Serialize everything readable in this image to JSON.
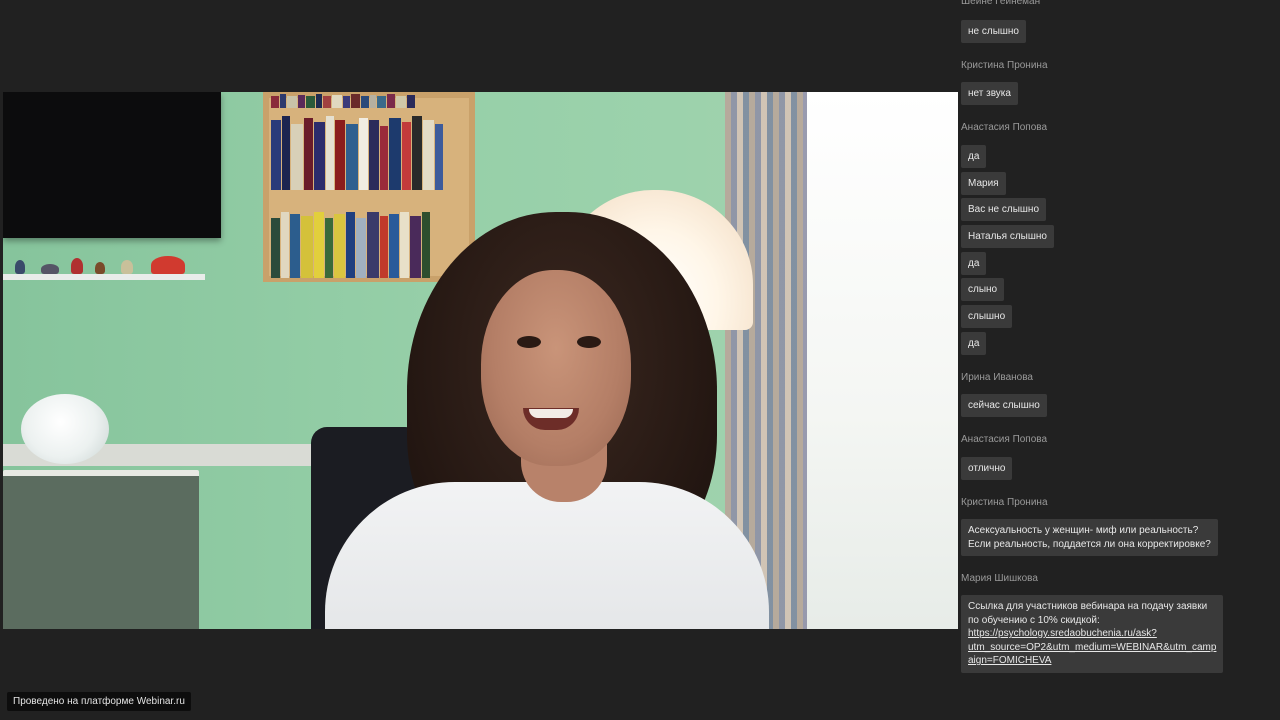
{
  "chat": {
    "top_author": "Шейне Гейнеман",
    "messages": [
      {
        "text": "не слышно"
      },
      {
        "author": "Кристина Пронина"
      },
      {
        "text": "нет звука"
      },
      {
        "author": "Анастасия Попова"
      },
      {
        "text": "да"
      },
      {
        "text": "Мария"
      },
      {
        "text": "Вас не слышно"
      },
      {
        "text": "Наталья слышно"
      },
      {
        "text": "да"
      },
      {
        "text": "слыно"
      },
      {
        "text": "слышно"
      },
      {
        "text": "да"
      },
      {
        "author": "Ирина Иванова"
      },
      {
        "text": "сейчас слышно"
      },
      {
        "author": "Анастасия Попова"
      },
      {
        "text": "отлично"
      },
      {
        "author": "Кристина Пронина"
      },
      {
        "lines": [
          "Асексуальность у женщин- миф или реальность?",
          "Если реальность, поддается ли она корректировке?"
        ]
      },
      {
        "author": "Мария Шишкова"
      },
      {
        "lines": [
          "Ссылка для участников вебинара на подачу заявки",
          "по обучению с 10% скидкой:"
        ],
        "link_lines": [
          "https://psychology.sredaobuchenia.ru/ask?",
          "utm_source=OP2&utm_medium=WEBINAR&utm_camp",
          "aign=FOMICHEVA"
        ]
      }
    ]
  },
  "footer": {
    "platform_label": "Проведено на платформе Webinar.ru"
  },
  "colors": {
    "background": "#212121",
    "bubble": "#3a3a3a",
    "author_text": "#9a9a9a"
  }
}
